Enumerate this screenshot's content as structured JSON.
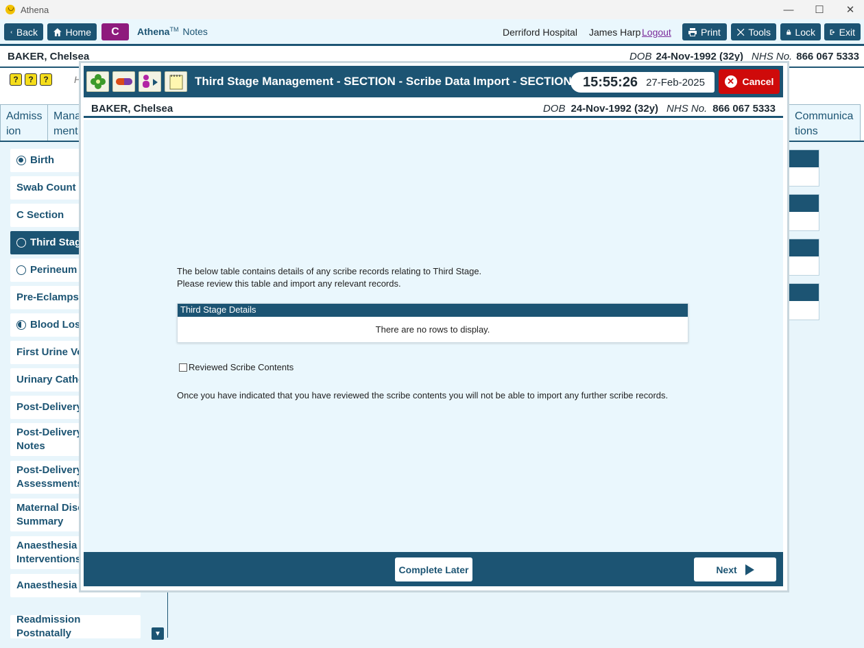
{
  "window": {
    "title": "Athena"
  },
  "toolbar": {
    "back_label": "Back",
    "home_label": "Home",
    "badge": "C",
    "brand_name": "Athena",
    "brand_tm": "TM",
    "brand_suffix": "Notes",
    "hospital": "Derriford Hospital",
    "user": "James Harp",
    "logout_label": "Logout",
    "print_label": "Print",
    "tools_label": "Tools",
    "lock_label": "Lock",
    "exit_label": "Exit"
  },
  "patient": {
    "name": "BAKER, Chelsea",
    "dob_label": "DOB",
    "dob": "24-Nov-1992 (32y)",
    "nhs_label": "NHS No.",
    "nhs": "866 067 5333"
  },
  "background": {
    "help_icons": [
      "?",
      "?",
      "?"
    ],
    "heading_fragment": "H",
    "tabs": [
      {
        "line1": "Admiss",
        "line2": "ion"
      },
      {
        "line1": "Mana",
        "line2": "ment"
      },
      {
        "line1": "Communica",
        "line2": "tions"
      }
    ],
    "sidebar": [
      {
        "label": "Birth",
        "status": "filled"
      },
      {
        "label": "Swab Count",
        "status": ""
      },
      {
        "label": "C Section",
        "status": ""
      },
      {
        "label": "Third Stage",
        "status": "empty",
        "active": true
      },
      {
        "label": "Perineum",
        "status": "empty"
      },
      {
        "label": "Pre-Eclampsia",
        "status": ""
      },
      {
        "label": "Blood Loss",
        "status": "half"
      },
      {
        "label": "First Urine Voi",
        "status": ""
      },
      {
        "label": "Urinary Cathe",
        "status": ""
      },
      {
        "label": "Post-Delivery",
        "status": ""
      },
      {
        "label": "Post-Delivery Notes",
        "line1": "Post-Delivery",
        "line2": "Notes"
      },
      {
        "label": "Post-Delivery Assessments",
        "line1": "Post-Delivery",
        "line2": "Assessments"
      },
      {
        "label": "Maternal Disc Summary",
        "line1": "Maternal Disc",
        "line2": "Summary"
      },
      {
        "label": "Anaesthesia Interventions",
        "line1": "Anaesthesia",
        "line2": "Interventions"
      },
      {
        "label": "Anaesthesia Fo",
        "status": ""
      },
      {
        "label": "Readmission Postnatally",
        "status": ""
      }
    ]
  },
  "modal": {
    "title": "Third Stage Management - SECTION - Scribe Data Import - SECTION - S",
    "time": "15:55:26",
    "date": "27-Feb-2025",
    "cancel_label": "Cancel",
    "intro_line1": "The below table contains details of any scribe records relating to Third Stage.",
    "intro_line2": "Please review this table and import any relevant records.",
    "grid_title": "Third Stage Details",
    "grid_empty": "There are no rows to display.",
    "checkbox_label": "Reviewed Scribe Contents",
    "checkbox_checked": false,
    "note": "Once you have indicated that you have reviewed the scribe contents you will not be able to import any further scribe records.",
    "complete_later_label": "Complete Later",
    "next_label": "Next"
  },
  "colors": {
    "primary": "#1c5473",
    "cancel": "#cf0a0a",
    "badge": "#8e1b7d",
    "background": "#eaf7fd"
  }
}
